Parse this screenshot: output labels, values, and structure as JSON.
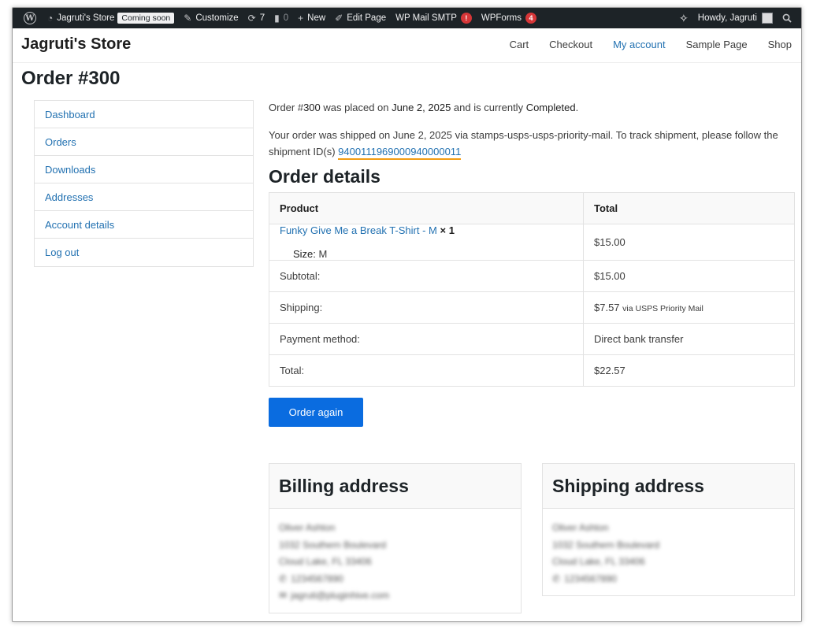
{
  "adminbar": {
    "wp_logo": "W",
    "site_name": "Jagruti's Store",
    "coming_soon": "Coming soon",
    "customize": "Customize",
    "updates_count": "7",
    "comments_count": "0",
    "new_label": "New",
    "edit_page": "Edit Page",
    "wp_mail_smtp": "WP Mail SMTP",
    "wp_mail_smtp_badge": "!",
    "wpforms": "WPForms",
    "wpforms_badge": "4",
    "howdy": "Howdy, Jagruti"
  },
  "header": {
    "site_title": "Jagruti's Store",
    "nav": [
      "Cart",
      "Checkout",
      "My account",
      "Sample Page",
      "Shop"
    ],
    "active_nav": "My account"
  },
  "page_title": "Order #300",
  "sidebar": {
    "items": [
      "Dashboard",
      "Orders",
      "Downloads",
      "Addresses",
      "Account details",
      "Log out"
    ]
  },
  "order": {
    "summary_prefix": "Order #",
    "number": "300",
    "summary_mid": " was placed on ",
    "date": "June 2, 2025",
    "summary_mid2": " and is currently ",
    "status": "Completed",
    "summary_end": ".",
    "shipping_note": "Your order was shipped on June 2, 2025 via stamps-usps-usps-priority-mail. To track shipment, please follow the shipment ID(s) ",
    "tracking_id": "9400111969000940000011",
    "details_title": "Order details",
    "table": {
      "col_product": "Product",
      "col_total": "Total",
      "product_name": "Funky Give Me a Break T-Shirt - M",
      "product_qty": "× 1",
      "product_meta_label": "Size:",
      "product_meta_value": "M",
      "product_total": "$15.00",
      "rows": [
        {
          "label": "Subtotal:",
          "value": "$15.00",
          "note": ""
        },
        {
          "label": "Shipping:",
          "value": "$7.57",
          "note": "via USPS Priority Mail"
        },
        {
          "label": "Payment method:",
          "value": "Direct bank transfer",
          "note": ""
        },
        {
          "label": "Total:",
          "value": "$22.57",
          "note": ""
        }
      ]
    },
    "order_again": "Order again"
  },
  "billing": {
    "title": "Billing address",
    "name": "Oliver Ashton",
    "street": "1032 Southern Boulevard",
    "city": "Cloud Lake, FL 33406",
    "phone": "1234567890",
    "email": "jagruti@pluginhive.com"
  },
  "shipping": {
    "title": "Shipping address",
    "name": "Oliver Ashton",
    "street": "1032 Southern Boulevard",
    "city": "Cloud Lake, FL 33406",
    "phone": "1234567890"
  },
  "colors": {
    "accent": "#2271b1",
    "button": "#0a6ce0",
    "adminbar": "#1d2327",
    "badge": "#d63638",
    "highlight": "#f39c12"
  }
}
